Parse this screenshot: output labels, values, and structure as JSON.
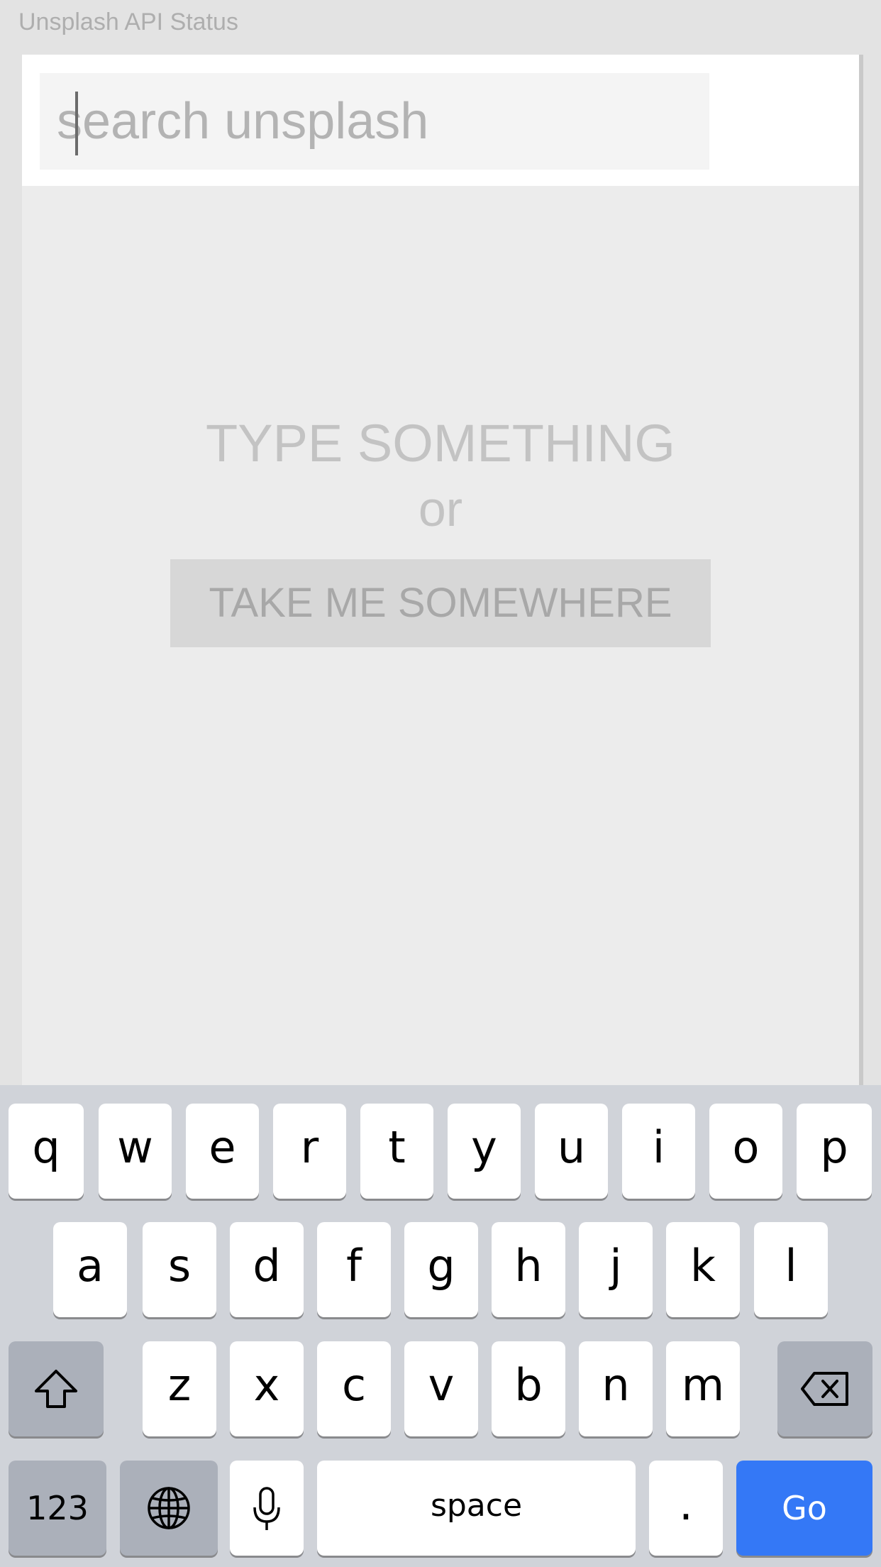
{
  "header": {
    "status_link": "Unsplash API Status"
  },
  "search": {
    "placeholder": "search unsplash",
    "value": ""
  },
  "empty_state": {
    "title": "TYPE SOMETHING",
    "or": "or",
    "button": "TAKE ME SOMEWHERE"
  },
  "keyboard": {
    "row1": [
      "q",
      "w",
      "e",
      "r",
      "t",
      "y",
      "u",
      "i",
      "o",
      "p"
    ],
    "row2": [
      "a",
      "s",
      "d",
      "f",
      "g",
      "h",
      "j",
      "k",
      "l"
    ],
    "row3": [
      "z",
      "x",
      "c",
      "v",
      "b",
      "n",
      "m"
    ],
    "numbers_label": "123",
    "space_label": "space",
    "period_label": ".",
    "go_label": "Go",
    "icons": {
      "shift": "shift-icon",
      "delete": "backspace-icon",
      "globe": "globe-icon",
      "mic": "microphone-icon"
    },
    "accent_color": "#3478f6"
  }
}
